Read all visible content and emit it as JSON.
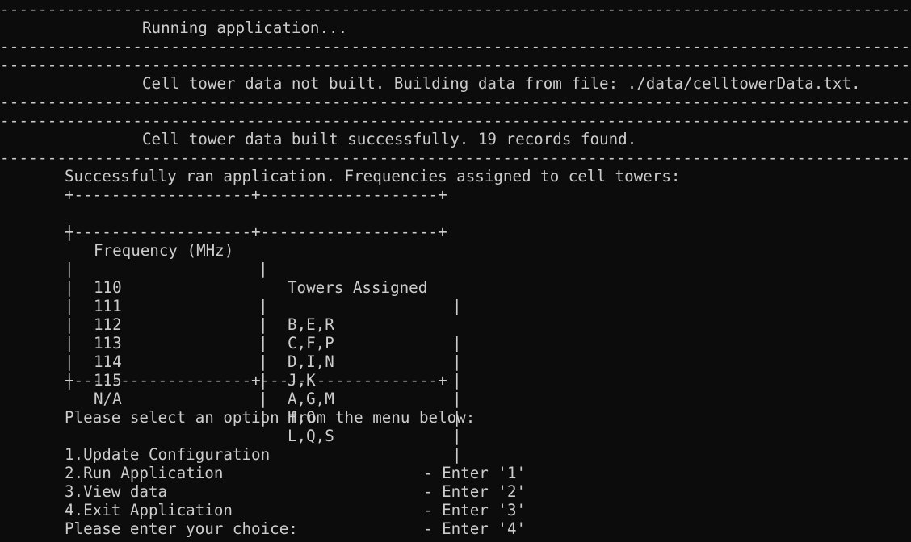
{
  "separator": "------------------------------------------------------------------------------------------------------------------------------------",
  "messages": [
    "Running application...",
    "Cell tower data not built. Building data from file: ./data/celltowerData.txt.",
    "Cell tower data built successfully. 19 records found."
  ],
  "result_heading": "Successfully ran application. Frequencies assigned to cell towers:",
  "table": {
    "border": "+-------------------+-------------------+",
    "pipe": "|",
    "headers": [
      "Frequency (MHz)",
      "Towers Assigned"
    ],
    "rows": [
      [
        "110",
        "B,E,R"
      ],
      [
        "111",
        "C,F,P"
      ],
      [
        "112",
        "D,I,N"
      ],
      [
        "113",
        "J,K"
      ],
      [
        "114",
        "A,G,M"
      ],
      [
        "115",
        "H,O"
      ],
      [
        "N/A",
        "L,Q,S"
      ]
    ]
  },
  "menu": {
    "prompt": "Please select an option from the menu below:",
    "items": [
      {
        "label": "1.Update Configuration",
        "key": "- Enter '1'"
      },
      {
        "label": "2.Run Application",
        "key": "- Enter '2'"
      },
      {
        "label": "3.View data",
        "key": "- Enter '3'"
      },
      {
        "label": "4.Exit Application",
        "key": "- Enter '4'"
      }
    ]
  },
  "input_prompt": "Please enter your choice:"
}
